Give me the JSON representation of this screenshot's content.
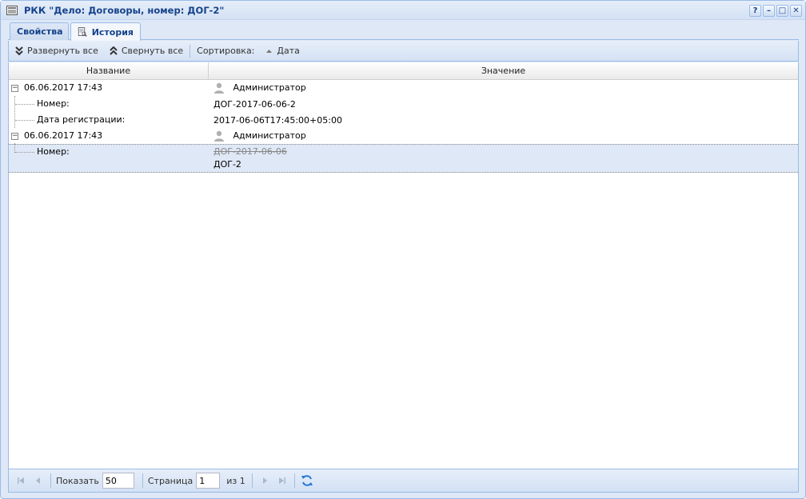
{
  "window": {
    "title": "РКК \"Дело: Договоры, номер: ДОГ-2\"",
    "tools": [
      "?",
      "–",
      "□",
      "✕"
    ]
  },
  "tabs": [
    {
      "label": "Свойства",
      "active": false
    },
    {
      "label": "История",
      "active": true
    }
  ],
  "toolbar": {
    "expand_all": "Развернуть все",
    "collapse_all": "Свернуть все",
    "sort_label": "Сортировка:",
    "sort_field": "Дата"
  },
  "grid": {
    "columns": {
      "name": "Название",
      "value": "Значение"
    },
    "rows": [
      {
        "type": "group",
        "name": "06.06.2017 17:43",
        "value": "Администратор"
      },
      {
        "type": "child",
        "name": "Номер:",
        "value": "ДОГ-2017-06-06-2"
      },
      {
        "type": "child",
        "name": "Дата регистрации:",
        "value": "2017-06-06T17:45:00+05:00"
      },
      {
        "type": "group",
        "name": "06.06.2017 17:43",
        "value": "Администратор"
      },
      {
        "type": "child-change",
        "name": "Номер:",
        "old_value": "ДОГ-2017-06-06",
        "new_value": "ДОГ-2",
        "selected": true
      }
    ]
  },
  "paging": {
    "show_label": "Показать",
    "page_size": "50",
    "page_label": "Страница",
    "page": "1",
    "of_label": "из 1"
  }
}
